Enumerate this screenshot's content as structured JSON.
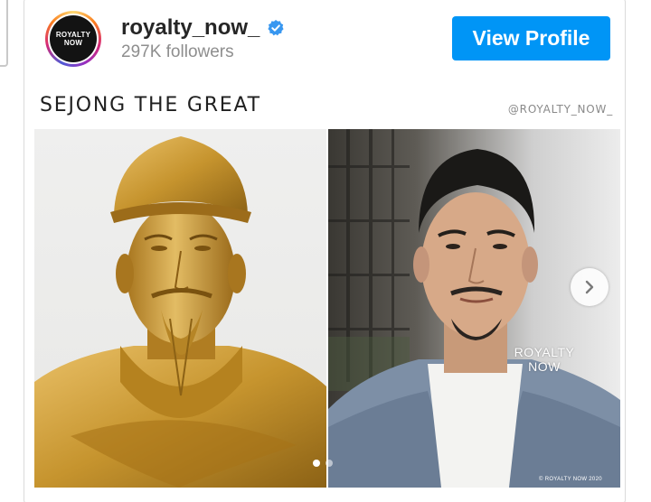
{
  "account": {
    "avatar_line1": "ROYALTY",
    "avatar_line2": "NOW",
    "username": "royalty_now_",
    "followers": "297K followers",
    "verified_icon": "verified-badge-icon"
  },
  "actions": {
    "view_profile_label": "View Profile"
  },
  "post": {
    "title": "SEJONG THE GREAT",
    "handle": "@ROYALTY_NOW_",
    "overlay_brand_line1": "ROYALTY",
    "overlay_brand_line2": "NOW",
    "overlay_copyright": "© ROYALTY NOW 2020",
    "carousel_dots": 2,
    "carousel_active": 1,
    "next_icon": "chevron-right-icon"
  },
  "colors": {
    "accent": "#0095f6",
    "verified": "#3897f0",
    "username": "#262626",
    "muted": "#8e8e8e"
  }
}
